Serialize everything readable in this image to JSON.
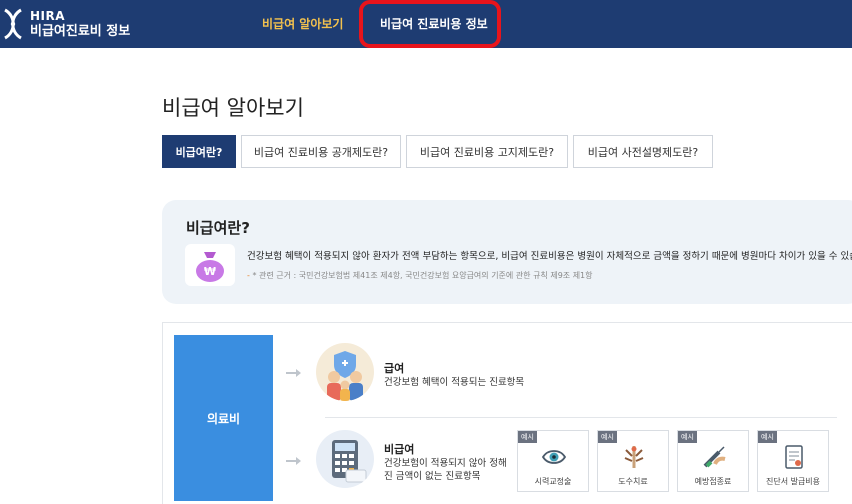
{
  "header": {
    "logo_line1": "HIRA",
    "logo_line2": "비급여진료비 정보",
    "nav": [
      {
        "label": "비급여 알아보기",
        "active": true
      },
      {
        "label": "비급여 진료비용 정보",
        "active": false
      }
    ],
    "accent_color": "#f2c14e",
    "bg_color": "#1e3c72",
    "highlight_color": "#e8141b"
  },
  "page": {
    "title": "비급여 알아보기"
  },
  "tabs": [
    {
      "label": "비급여란?",
      "active": true
    },
    {
      "label": "비급여 진료비용 공개제도란?",
      "active": false
    },
    {
      "label": "비급여 진료비용 고지제도란?",
      "active": false
    },
    {
      "label": "비급여 사전설명제도란?",
      "active": false
    }
  ],
  "info": {
    "title": "비급여란?",
    "description": "건강보험 혜택이 적용되지 않아 환자가 전액 부담하는 항목으로, 비급여 진료비용은 병원이 자체적으로 금액을 정하기 때문에 병원마다 차이가 있을 수 있습",
    "note_marker": "-",
    "note": "* 관련 근거 : 국민건강보험법 제41조 제4항, 국민건강보험 요양급여의 기준에 관한 규칙 제9조 제1항",
    "icon": "money-bag-icon"
  },
  "diagram": {
    "root_label": "의료비",
    "covered": {
      "title": "급여",
      "desc": "건강보험 혜택이 적용되는 진료항목",
      "icon": "family-shield-icon"
    },
    "uncovered": {
      "title": "비급여",
      "desc": "건강보험이 적용되지 않아 정해진 금액이 없는 진료항목",
      "icon": "calculator-icon"
    },
    "examples": [
      {
        "badge": "예시",
        "label": "시력교정술",
        "icon": "eye-icon"
      },
      {
        "badge": "예시",
        "label": "도수치료",
        "icon": "manual-therapy-icon"
      },
      {
        "badge": "예시",
        "label": "예방접종료",
        "icon": "syringe-icon"
      },
      {
        "badge": "예시",
        "label": "진단서 발급비용",
        "icon": "certificate-icon"
      }
    ]
  }
}
